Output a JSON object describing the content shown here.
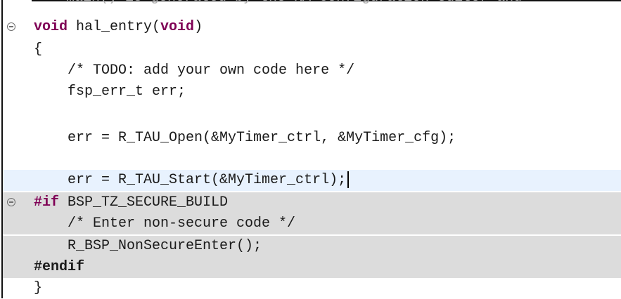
{
  "editor": {
    "clipped_top_line": "main() is generated by the RA Configuration editor and",
    "lines": [
      {
        "id": "l1",
        "text_parts": [
          {
            "t": "void",
            "c": "kw"
          },
          {
            "t": " hal_entry("
          },
          {
            "t": "void",
            "c": "kw"
          },
          {
            "t": ")"
          }
        ]
      },
      {
        "id": "l2",
        "text_parts": [
          {
            "t": "{"
          }
        ]
      },
      {
        "id": "l3",
        "text_parts": [
          {
            "t": "    /* TODO: add your own code here */",
            "c": "cm"
          }
        ]
      },
      {
        "id": "l4",
        "text_parts": [
          {
            "t": "    fsp_err_t err;"
          }
        ]
      },
      {
        "id": "l5",
        "text_parts": [
          {
            "t": ""
          }
        ]
      },
      {
        "id": "l6",
        "text_parts": [
          {
            "t": "    err = R_TAU_Open(&MyTimer_ctrl, &MyTimer_cfg);"
          }
        ]
      },
      {
        "id": "l7",
        "text_parts": [
          {
            "t": ""
          }
        ]
      },
      {
        "id": "l8",
        "text_parts": [
          {
            "t": "    err = R_TAU_Start(&MyTimer_ctrl);"
          }
        ]
      },
      {
        "id": "l9",
        "text_parts": [
          {
            "t": "#if",
            "c": "pp"
          },
          {
            "t": " BSP_TZ_SECURE_BUILD"
          }
        ]
      },
      {
        "id": "l10",
        "text_parts": [
          {
            "t": "    /* Enter non-secure code */",
            "c": "cm"
          }
        ]
      },
      {
        "id": "l11",
        "text_parts": [
          {
            "t": "    R_BSP_NonSecureEnter();"
          }
        ]
      },
      {
        "id": "l12",
        "text_parts": [
          {
            "t": "#endif",
            "c": "pp"
          }
        ]
      },
      {
        "id": "l13",
        "text_parts": [
          {
            "t": "}"
          }
        ]
      }
    ],
    "fold_icon": "fold-collapse-icon"
  }
}
